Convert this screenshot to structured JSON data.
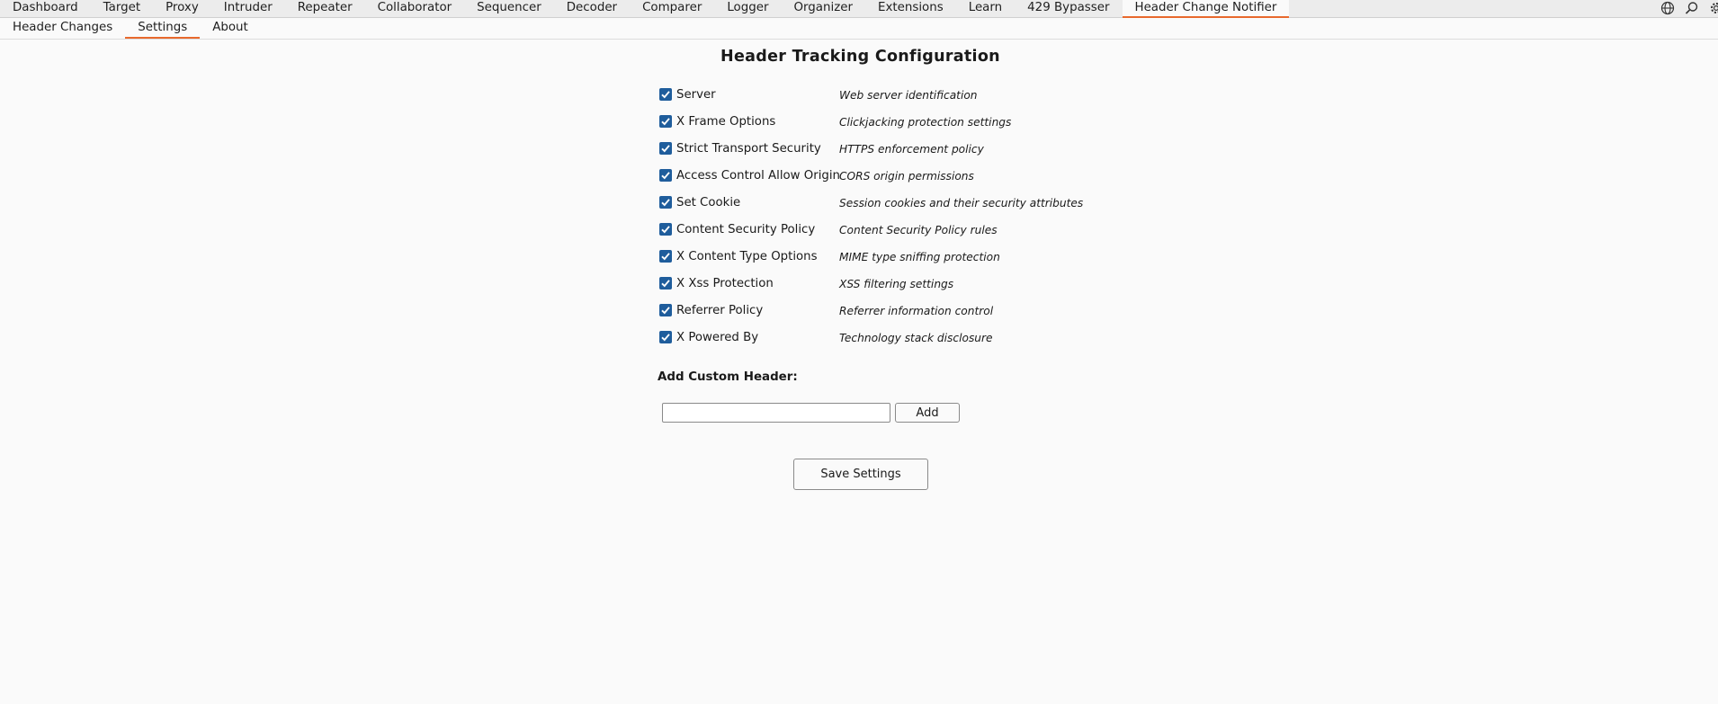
{
  "top_tabs": [
    "Dashboard",
    "Target",
    "Proxy",
    "Intruder",
    "Repeater",
    "Collaborator",
    "Sequencer",
    "Decoder",
    "Comparer",
    "Logger",
    "Organizer",
    "Extensions",
    "Learn",
    "429 Bypasser",
    "Header Change Notifier"
  ],
  "top_active": "Header Change Notifier",
  "top_icons": [
    "globe-icon",
    "search-icon",
    "settings-icon"
  ],
  "sub_tabs": [
    "Header Changes",
    "Settings",
    "About"
  ],
  "sub_active": "Settings",
  "title": "Header Tracking Configuration",
  "headers": [
    {
      "name": "Server",
      "desc": "Web server identification",
      "checked": true
    },
    {
      "name": "X Frame Options",
      "desc": "Clickjacking protection settings",
      "checked": true
    },
    {
      "name": "Strict Transport Security",
      "desc": "HTTPS enforcement policy",
      "checked": true
    },
    {
      "name": "Access Control Allow Origin",
      "desc": "CORS origin permissions",
      "checked": true
    },
    {
      "name": "Set Cookie",
      "desc": "Session cookies and their security attributes",
      "checked": true
    },
    {
      "name": "Content Security Policy",
      "desc": "Content Security Policy rules",
      "checked": true
    },
    {
      "name": "X Content Type Options",
      "desc": "MIME type sniffing protection",
      "checked": true
    },
    {
      "name": "X Xss Protection",
      "desc": "XSS filtering settings",
      "checked": true
    },
    {
      "name": "Referrer Policy",
      "desc": "Referrer information control",
      "checked": true
    },
    {
      "name": "X Powered By",
      "desc": "Technology stack disclosure",
      "checked": true
    }
  ],
  "custom": {
    "label": "Add Custom Header:",
    "input_value": "",
    "add_label": "Add"
  },
  "save_label": "Save Settings",
  "accent_color": "#e8692d",
  "checkbox_color": "#1f5d9c"
}
